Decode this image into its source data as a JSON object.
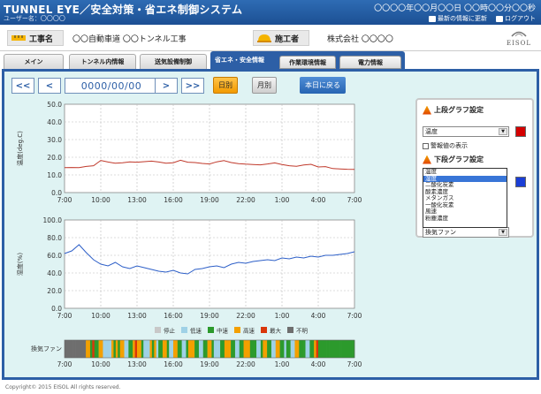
{
  "header": {
    "title": "TUNNEL EYE／安全対策・省エネ制御システム",
    "user": "ユーザー名：〇〇〇〇",
    "datetime": "〇〇〇〇年〇〇月〇〇日 〇〇時〇〇分〇〇秒",
    "link_update": "最新の情報に更新",
    "link_logout": "ログアウト"
  },
  "info": {
    "project_label": "工事名",
    "project_value": "〇〇自動車道 〇〇トンネル工事",
    "contractor_label": "施工者",
    "contractor_value": "株式会社 〇〇〇〇",
    "logo": "EISOL"
  },
  "tabs": [
    "メイン",
    "トンネル内情報",
    "送気設備制御",
    "省エネ・安全情報"
  ],
  "subtabs": [
    "作業環境情報",
    "電力情報"
  ],
  "toolbar": {
    "first": "<<",
    "prev": "<",
    "date": "0000/00/00",
    "next": ">",
    "last": ">>",
    "day": "日別",
    "month": "月別",
    "today": "本日に戻る"
  },
  "panel": {
    "upper_title": "上段グラフ設定",
    "upper_selected": "温度",
    "upper_color": "#d40000",
    "warn_line": "警報値の表示",
    "lower_title": "下段グラフ設定",
    "lower_color": "#1a3ed6",
    "bottom_selected": "換気ファン",
    "options": [
      "温度",
      "湿度",
      "二酸化炭素",
      "酸素濃度",
      "メタンガス",
      "一酸化炭素",
      "風速",
      "粉塵濃度"
    ],
    "highlighted_option": "湿度"
  },
  "chart_data": [
    {
      "type": "line",
      "ylabel": "温度(deg.C)",
      "ylim": [
        0,
        50
      ],
      "yticks": [
        "0.0",
        "10.0",
        "20.0",
        "30.0",
        "40.0",
        "50.0"
      ],
      "xticks": [
        "7:00",
        "10:00",
        "13:00",
        "16:00",
        "19:00",
        "22:00",
        "1:00",
        "4:00",
        "7:00"
      ],
      "color": "#c0392b",
      "series": [
        {
          "values": [
            14.1,
            14.2,
            14.1,
            14.8,
            15.2,
            18.2,
            17.3,
            16.6,
            16.9,
            17.4,
            17.2,
            17.5,
            17.8,
            17.3,
            16.6,
            16.9,
            18.3,
            17.2,
            17.0,
            16.5,
            16.2,
            17.4,
            18.1,
            17.0,
            16.4,
            16.1,
            15.9,
            15.7,
            16.2,
            16.8,
            15.9,
            15.2,
            14.9,
            15.6,
            16.0,
            14.5,
            14.7,
            13.6,
            13.4,
            13.2,
            13.1
          ]
        }
      ]
    },
    {
      "type": "line",
      "ylabel": "湿度(%)",
      "ylim": [
        0,
        100
      ],
      "yticks": [
        "0.0",
        "20.0",
        "40.0",
        "60.0",
        "80.0",
        "100.0"
      ],
      "xticks": [
        "7:00",
        "10:00",
        "13:00",
        "16:00",
        "19:00",
        "22:00",
        "1:00",
        "4:00",
        "7:00"
      ],
      "color": "#2d5fc8",
      "series": [
        {
          "values": [
            62,
            65,
            72,
            63,
            55,
            50,
            48,
            52,
            47,
            45,
            48,
            46,
            44,
            42,
            41,
            43,
            40,
            39,
            44,
            45,
            47,
            48,
            46,
            50,
            52,
            51,
            53,
            54,
            55,
            54,
            57,
            56,
            58,
            57,
            59,
            58,
            60,
            60,
            61,
            62,
            64
          ]
        }
      ]
    },
    {
      "type": "heatmap",
      "label": "換気ファン",
      "legend": [
        {
          "name": "停止",
          "color": "#c8c8c8"
        },
        {
          "name": "低速",
          "color": "#9fd1e6"
        },
        {
          "name": "中速",
          "color": "#2c9a2c"
        },
        {
          "name": "高速",
          "color": "#f3a000"
        },
        {
          "name": "最大",
          "color": "#d9360b"
        },
        {
          "name": "不明",
          "color": "#6e6e6e"
        }
      ],
      "states": [
        5,
        5,
        5,
        5,
        5,
        5,
        5,
        5,
        5,
        5,
        3,
        3,
        2,
        4,
        2,
        2,
        3,
        3,
        1,
        1,
        1,
        1,
        3,
        2,
        3,
        2,
        3,
        3,
        1,
        1,
        2,
        2,
        3,
        4,
        3,
        3,
        2,
        1,
        1,
        1,
        3,
        2,
        3,
        1,
        2,
        2,
        3,
        3,
        2,
        1,
        1,
        3,
        3,
        2,
        2,
        1,
        1,
        2,
        3,
        3,
        3,
        2,
        2,
        1,
        1,
        2,
        2,
        3,
        3,
        2,
        1,
        1,
        1,
        2,
        2,
        3,
        3,
        3,
        2,
        2,
        1,
        1,
        2,
        2,
        3,
        3,
        3,
        2,
        2,
        2,
        1,
        1,
        2,
        3,
        3,
        2,
        2,
        1,
        1,
        3,
        3,
        2,
        2,
        1,
        2,
        2,
        1,
        1,
        3,
        3,
        2,
        2,
        2,
        1,
        1,
        2,
        2,
        3,
        4,
        2,
        2,
        2,
        2,
        2,
        2,
        2,
        2,
        2,
        2,
        2,
        2,
        2,
        2,
        2,
        2,
        2
      ],
      "xticks": [
        "7:00",
        "10:00",
        "13:00",
        "16:00",
        "19:00",
        "22:00",
        "1:00",
        "4:00",
        "7:00"
      ]
    }
  ],
  "copyright": "Copyright© 2015 EISOL All rights reserved."
}
